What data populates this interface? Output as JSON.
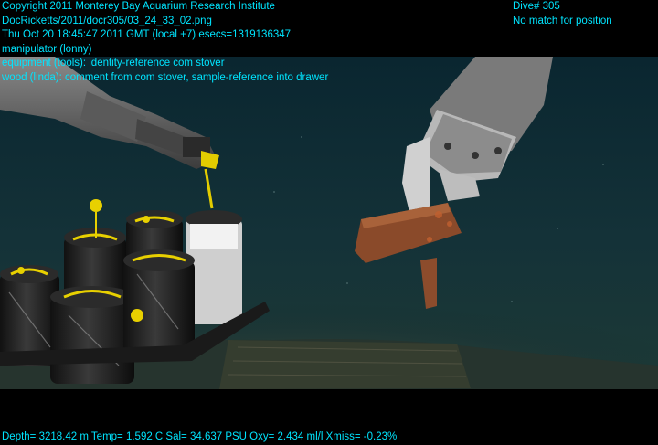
{
  "overlay": {
    "color": "#00e5ff",
    "top_left": [
      "Copyright 2011 Monterey Bay Aquarium Research Institute",
      "DocRicketts/2011/docr305/03_24_33_02.png",
      "Thu Oct 20 18:45:47 2011 GMT (local +7)  esecs=1319136347",
      "manipulator (lonny)",
      "equipment (tools): identity-reference com stover",
      "wood (linda): comment from com stover, sample-reference into drawer"
    ],
    "top_right": [
      "Dive# 305",
      "No match for position"
    ],
    "bottom": "Depth= 3218.42 m  Temp= 1.592 C  Sal= 34.637 PSU  Oxy= 2.434 ml/l  Xmiss= -0.23%"
  },
  "scene": {
    "water_color": "#123036",
    "seafloor_color": "#2a3a32",
    "wood_color": "#8a4a2a",
    "marker_color": "#e8d000"
  }
}
